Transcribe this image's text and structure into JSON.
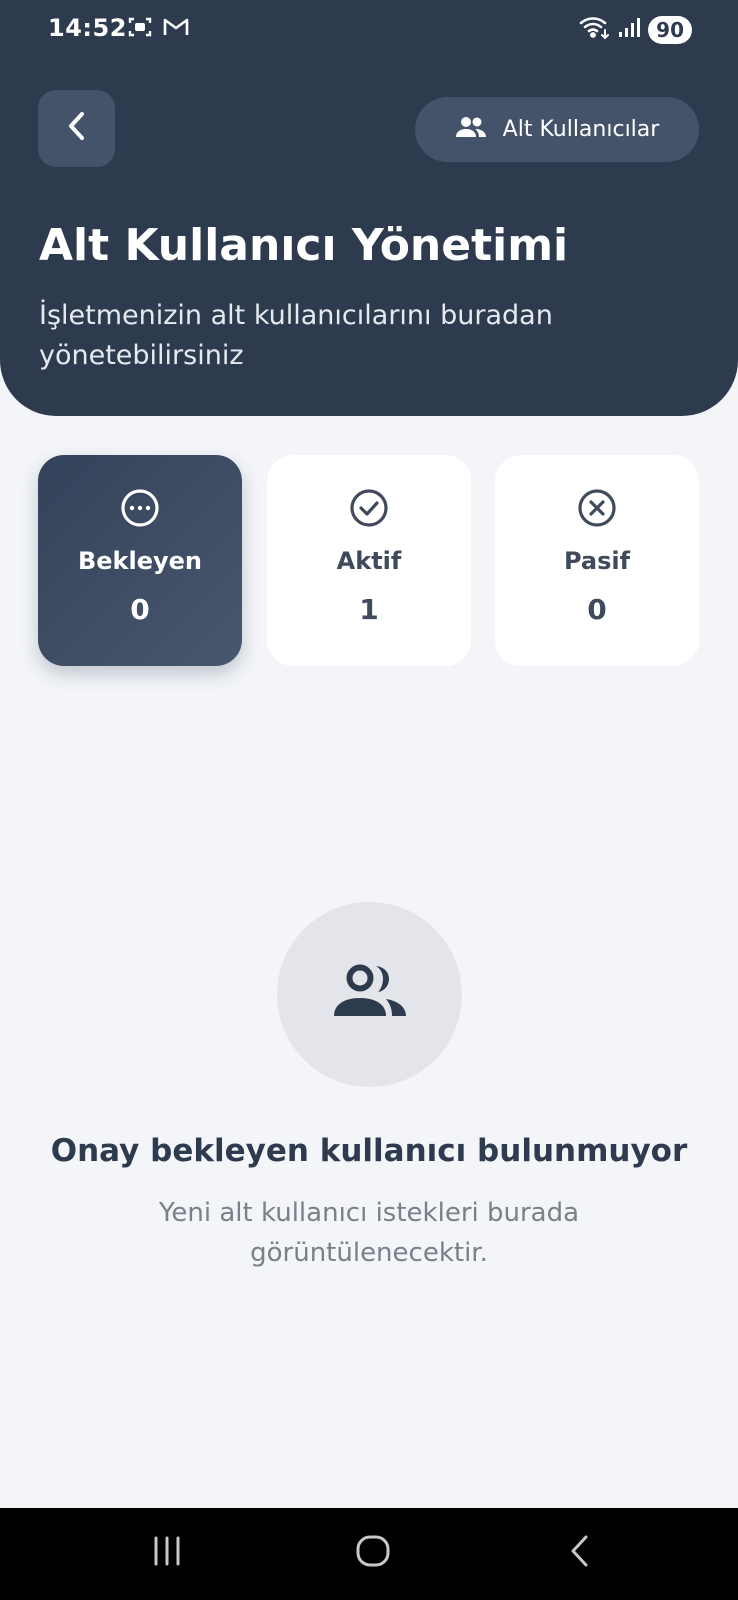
{
  "status_bar": {
    "time": "14:52",
    "battery": "90",
    "left_icons": [
      "screen-record-icon",
      "gmail-icon"
    ],
    "right_icons": [
      "wifi-icon",
      "signal-icon"
    ]
  },
  "header": {
    "back_icon": "chevron-left-icon",
    "alt_button_label": "Alt Kullanıcılar",
    "alt_button_icon": "users-icon",
    "title": "Alt Kullanıcı Yönetimi",
    "subtitle": "İşletmenizin alt kullanıcılarını buradan yönetebilirsiniz",
    "background_color": "#2e3b4f"
  },
  "stats": [
    {
      "label": "Bekleyen",
      "value": "0",
      "icon": "pending-dots-icon",
      "selected": true
    },
    {
      "label": "Aktif",
      "value": "1",
      "icon": "check-circle-icon",
      "selected": false
    },
    {
      "label": "Pasif",
      "value": "0",
      "icon": "x-circle-icon",
      "selected": false
    }
  ],
  "empty_state": {
    "icon": "users-icon",
    "title": "Onay bekleyen kullanıcı bulunmuyor",
    "description": "Yeni alt kullanıcı istekleri burada görüntülenecektir."
  },
  "nav_bar": {
    "buttons": [
      "recent-apps-icon",
      "home-icon",
      "back-icon"
    ]
  }
}
